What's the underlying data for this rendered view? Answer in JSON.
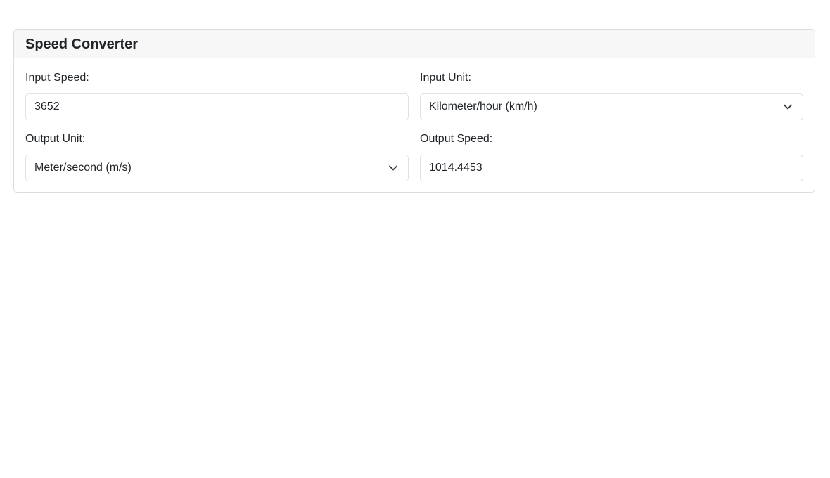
{
  "card": {
    "title": "Speed Converter"
  },
  "fields": {
    "input_speed": {
      "label": "Input Speed:",
      "value": "3652"
    },
    "input_unit": {
      "label": "Input Unit:",
      "selected": "Kilometer/hour (km/h)",
      "icon": "chevron-down-icon"
    },
    "output_unit": {
      "label": "Output Unit:",
      "selected": "Meter/second (m/s)",
      "icon": "chevron-down-icon"
    },
    "output_speed": {
      "label": "Output Speed:",
      "value": "1014.4453"
    }
  },
  "colors": {
    "header_bg": "#f7f7f7",
    "border": "#dcdcdc",
    "text": "#212529"
  }
}
